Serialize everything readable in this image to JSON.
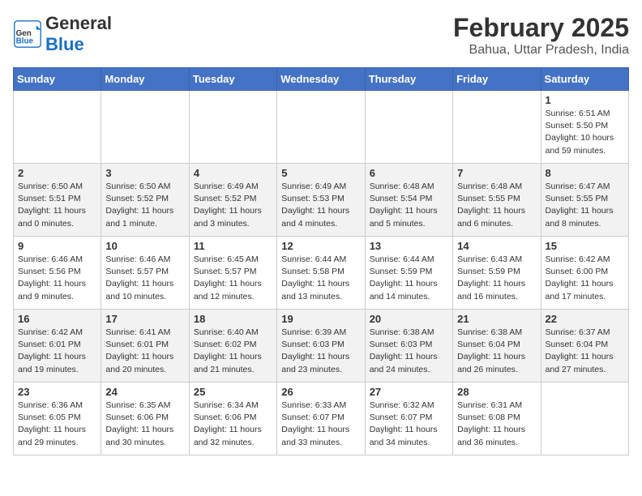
{
  "header": {
    "logo_general": "General",
    "logo_blue": "Blue",
    "month_year": "February 2025",
    "location": "Bahua, Uttar Pradesh, India"
  },
  "days_of_week": [
    "Sunday",
    "Monday",
    "Tuesday",
    "Wednesday",
    "Thursday",
    "Friday",
    "Saturday"
  ],
  "weeks": [
    [
      {
        "day": null,
        "info": null
      },
      {
        "day": null,
        "info": null
      },
      {
        "day": null,
        "info": null
      },
      {
        "day": null,
        "info": null
      },
      {
        "day": null,
        "info": null
      },
      {
        "day": null,
        "info": null
      },
      {
        "day": "1",
        "info": "Sunrise: 6:51 AM\nSunset: 5:50 PM\nDaylight: 10 hours\nand 59 minutes."
      }
    ],
    [
      {
        "day": "2",
        "info": "Sunrise: 6:50 AM\nSunset: 5:51 PM\nDaylight: 11 hours\nand 0 minutes."
      },
      {
        "day": "3",
        "info": "Sunrise: 6:50 AM\nSunset: 5:52 PM\nDaylight: 11 hours\nand 1 minute."
      },
      {
        "day": "4",
        "info": "Sunrise: 6:49 AM\nSunset: 5:52 PM\nDaylight: 11 hours\nand 3 minutes."
      },
      {
        "day": "5",
        "info": "Sunrise: 6:49 AM\nSunset: 5:53 PM\nDaylight: 11 hours\nand 4 minutes."
      },
      {
        "day": "6",
        "info": "Sunrise: 6:48 AM\nSunset: 5:54 PM\nDaylight: 11 hours\nand 5 minutes."
      },
      {
        "day": "7",
        "info": "Sunrise: 6:48 AM\nSunset: 5:55 PM\nDaylight: 11 hours\nand 6 minutes."
      },
      {
        "day": "8",
        "info": "Sunrise: 6:47 AM\nSunset: 5:55 PM\nDaylight: 11 hours\nand 8 minutes."
      }
    ],
    [
      {
        "day": "9",
        "info": "Sunrise: 6:46 AM\nSunset: 5:56 PM\nDaylight: 11 hours\nand 9 minutes."
      },
      {
        "day": "10",
        "info": "Sunrise: 6:46 AM\nSunset: 5:57 PM\nDaylight: 11 hours\nand 10 minutes."
      },
      {
        "day": "11",
        "info": "Sunrise: 6:45 AM\nSunset: 5:57 PM\nDaylight: 11 hours\nand 12 minutes."
      },
      {
        "day": "12",
        "info": "Sunrise: 6:44 AM\nSunset: 5:58 PM\nDaylight: 11 hours\nand 13 minutes."
      },
      {
        "day": "13",
        "info": "Sunrise: 6:44 AM\nSunset: 5:59 PM\nDaylight: 11 hours\nand 14 minutes."
      },
      {
        "day": "14",
        "info": "Sunrise: 6:43 AM\nSunset: 5:59 PM\nDaylight: 11 hours\nand 16 minutes."
      },
      {
        "day": "15",
        "info": "Sunrise: 6:42 AM\nSunset: 6:00 PM\nDaylight: 11 hours\nand 17 minutes."
      }
    ],
    [
      {
        "day": "16",
        "info": "Sunrise: 6:42 AM\nSunset: 6:01 PM\nDaylight: 11 hours\nand 19 minutes."
      },
      {
        "day": "17",
        "info": "Sunrise: 6:41 AM\nSunset: 6:01 PM\nDaylight: 11 hours\nand 20 minutes."
      },
      {
        "day": "18",
        "info": "Sunrise: 6:40 AM\nSunset: 6:02 PM\nDaylight: 11 hours\nand 21 minutes."
      },
      {
        "day": "19",
        "info": "Sunrise: 6:39 AM\nSunset: 6:03 PM\nDaylight: 11 hours\nand 23 minutes."
      },
      {
        "day": "20",
        "info": "Sunrise: 6:38 AM\nSunset: 6:03 PM\nDaylight: 11 hours\nand 24 minutes."
      },
      {
        "day": "21",
        "info": "Sunrise: 6:38 AM\nSunset: 6:04 PM\nDaylight: 11 hours\nand 26 minutes."
      },
      {
        "day": "22",
        "info": "Sunrise: 6:37 AM\nSunset: 6:04 PM\nDaylight: 11 hours\nand 27 minutes."
      }
    ],
    [
      {
        "day": "23",
        "info": "Sunrise: 6:36 AM\nSunset: 6:05 PM\nDaylight: 11 hours\nand 29 minutes."
      },
      {
        "day": "24",
        "info": "Sunrise: 6:35 AM\nSunset: 6:06 PM\nDaylight: 11 hours\nand 30 minutes."
      },
      {
        "day": "25",
        "info": "Sunrise: 6:34 AM\nSunset: 6:06 PM\nDaylight: 11 hours\nand 32 minutes."
      },
      {
        "day": "26",
        "info": "Sunrise: 6:33 AM\nSunset: 6:07 PM\nDaylight: 11 hours\nand 33 minutes."
      },
      {
        "day": "27",
        "info": "Sunrise: 6:32 AM\nSunset: 6:07 PM\nDaylight: 11 hours\nand 34 minutes."
      },
      {
        "day": "28",
        "info": "Sunrise: 6:31 AM\nSunset: 6:08 PM\nDaylight: 11 hours\nand 36 minutes."
      },
      {
        "day": null,
        "info": null
      }
    ]
  ]
}
